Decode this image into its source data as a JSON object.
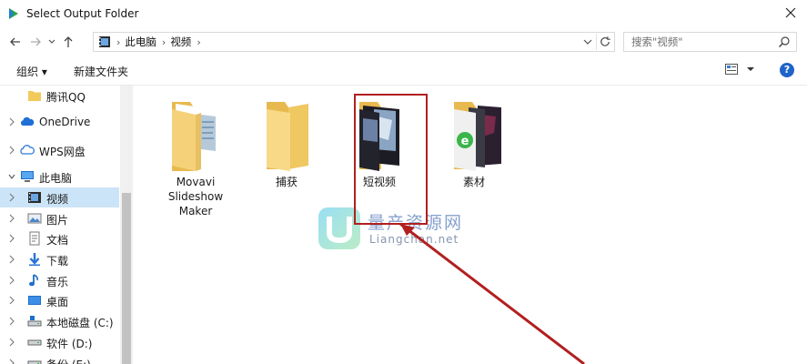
{
  "window": {
    "title": "Select Output Folder"
  },
  "address": {
    "path": [
      "此电脑",
      "视频"
    ]
  },
  "search": {
    "placeholder": "搜索\"视频\""
  },
  "toolbar": {
    "organize_label": "组织 ▾",
    "new_folder_label": "新建文件夹"
  },
  "sidebar": {
    "items": [
      {
        "label": "腾讯QQ",
        "icon": "folder-icon"
      },
      {
        "label": "OneDrive",
        "icon": "cloud-icon"
      },
      {
        "label": "WPS网盘",
        "icon": "cloud-drive-icon"
      },
      {
        "label": "此电脑",
        "icon": "computer-icon"
      },
      {
        "label": "视频",
        "icon": "video-folder-icon",
        "selected": true
      },
      {
        "label": "图片",
        "icon": "pictures-folder-icon"
      },
      {
        "label": "文档",
        "icon": "documents-folder-icon"
      },
      {
        "label": "下载",
        "icon": "download-folder-icon"
      },
      {
        "label": "音乐",
        "icon": "music-folder-icon"
      },
      {
        "label": "桌面",
        "icon": "desktop-folder-icon"
      },
      {
        "label": "本地磁盘 (C:)",
        "icon": "system-drive-icon"
      },
      {
        "label": "软件 (D:)",
        "icon": "drive-icon"
      },
      {
        "label": "备份 (E:)",
        "icon": "drive-icon"
      }
    ]
  },
  "folders": [
    {
      "label": "Movavi Slideshow Maker"
    },
    {
      "label": "捕获"
    },
    {
      "label": "短视频"
    },
    {
      "label": "素材"
    }
  ],
  "watermark": {
    "cn": "量产资源网",
    "en": "Liangchan.net"
  },
  "colors": {
    "selection": "#cce4f7",
    "annotation": "#b21f1f",
    "folder": "#f5d27a"
  }
}
